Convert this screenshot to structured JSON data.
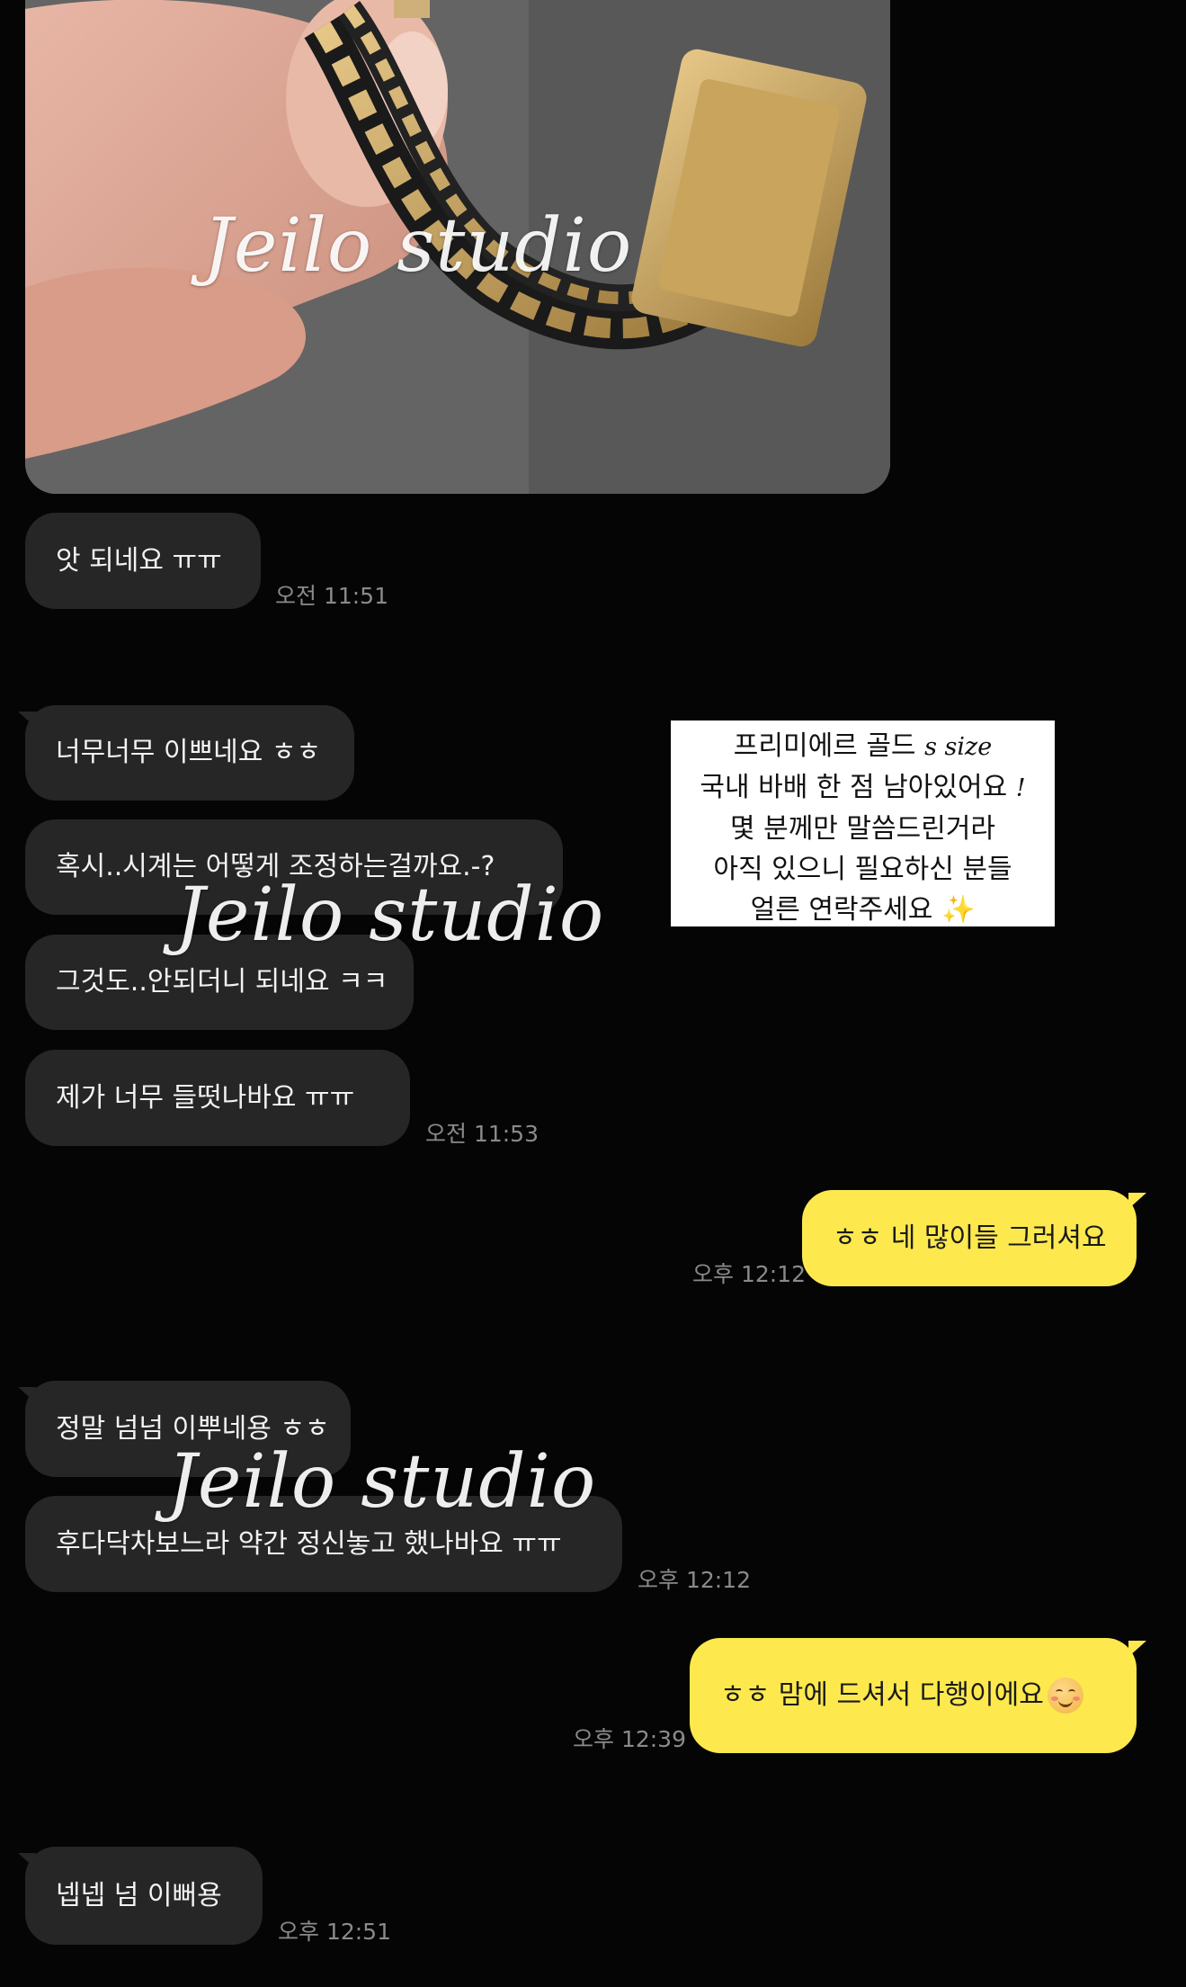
{
  "watermark": "Jeilo studio",
  "messages": [
    {
      "text": "앗 되네요 ㅠㅠ",
      "time": "오전 11:51"
    },
    {
      "text": "너무너무 이쁘네요 ㅎㅎ"
    },
    {
      "text": "혹시..시계는 어떻게 조정하는걸까요.-?"
    },
    {
      "text": "그것도..안되더니 되네요 ㅋㅋ"
    },
    {
      "text": "제가 너무 들떳나바요 ㅠㅠ",
      "time": "오전 11:53"
    },
    {
      "text": "ㅎㅎ 네 많이들 그러셔요",
      "time": "오후 12:12"
    },
    {
      "text": "정말 넘넘 이뿌네용 ㅎㅎ"
    },
    {
      "text": "후다닥차보느라 약간 정신놓고 했나바요 ㅠㅠ",
      "time": "오후 12:12"
    },
    {
      "text": "ㅎㅎ 맘에 드셔서 다행이에요",
      "emoji": "smiling-face-icon",
      "time": "오후 12:39"
    },
    {
      "text": "넵넵 넘 이뻐용",
      "time": "오후 12:51"
    }
  ],
  "notice": {
    "line1": "프리미에르 골드",
    "line1_em": "s size",
    "line2": "국내 바배 한 점 남아있어요",
    "line2_em": "!",
    "line3": "몇 분께만 말씀드린거라",
    "line4": "아직 있으니 필요하신 분들",
    "line5": "얼른 연락주세요",
    "sparkle": "✨"
  },
  "colors": {
    "background": "#050505",
    "incoming_bubble": "#262626",
    "outgoing_bubble": "#fde94e",
    "timestamp": "#8a8a8a"
  }
}
